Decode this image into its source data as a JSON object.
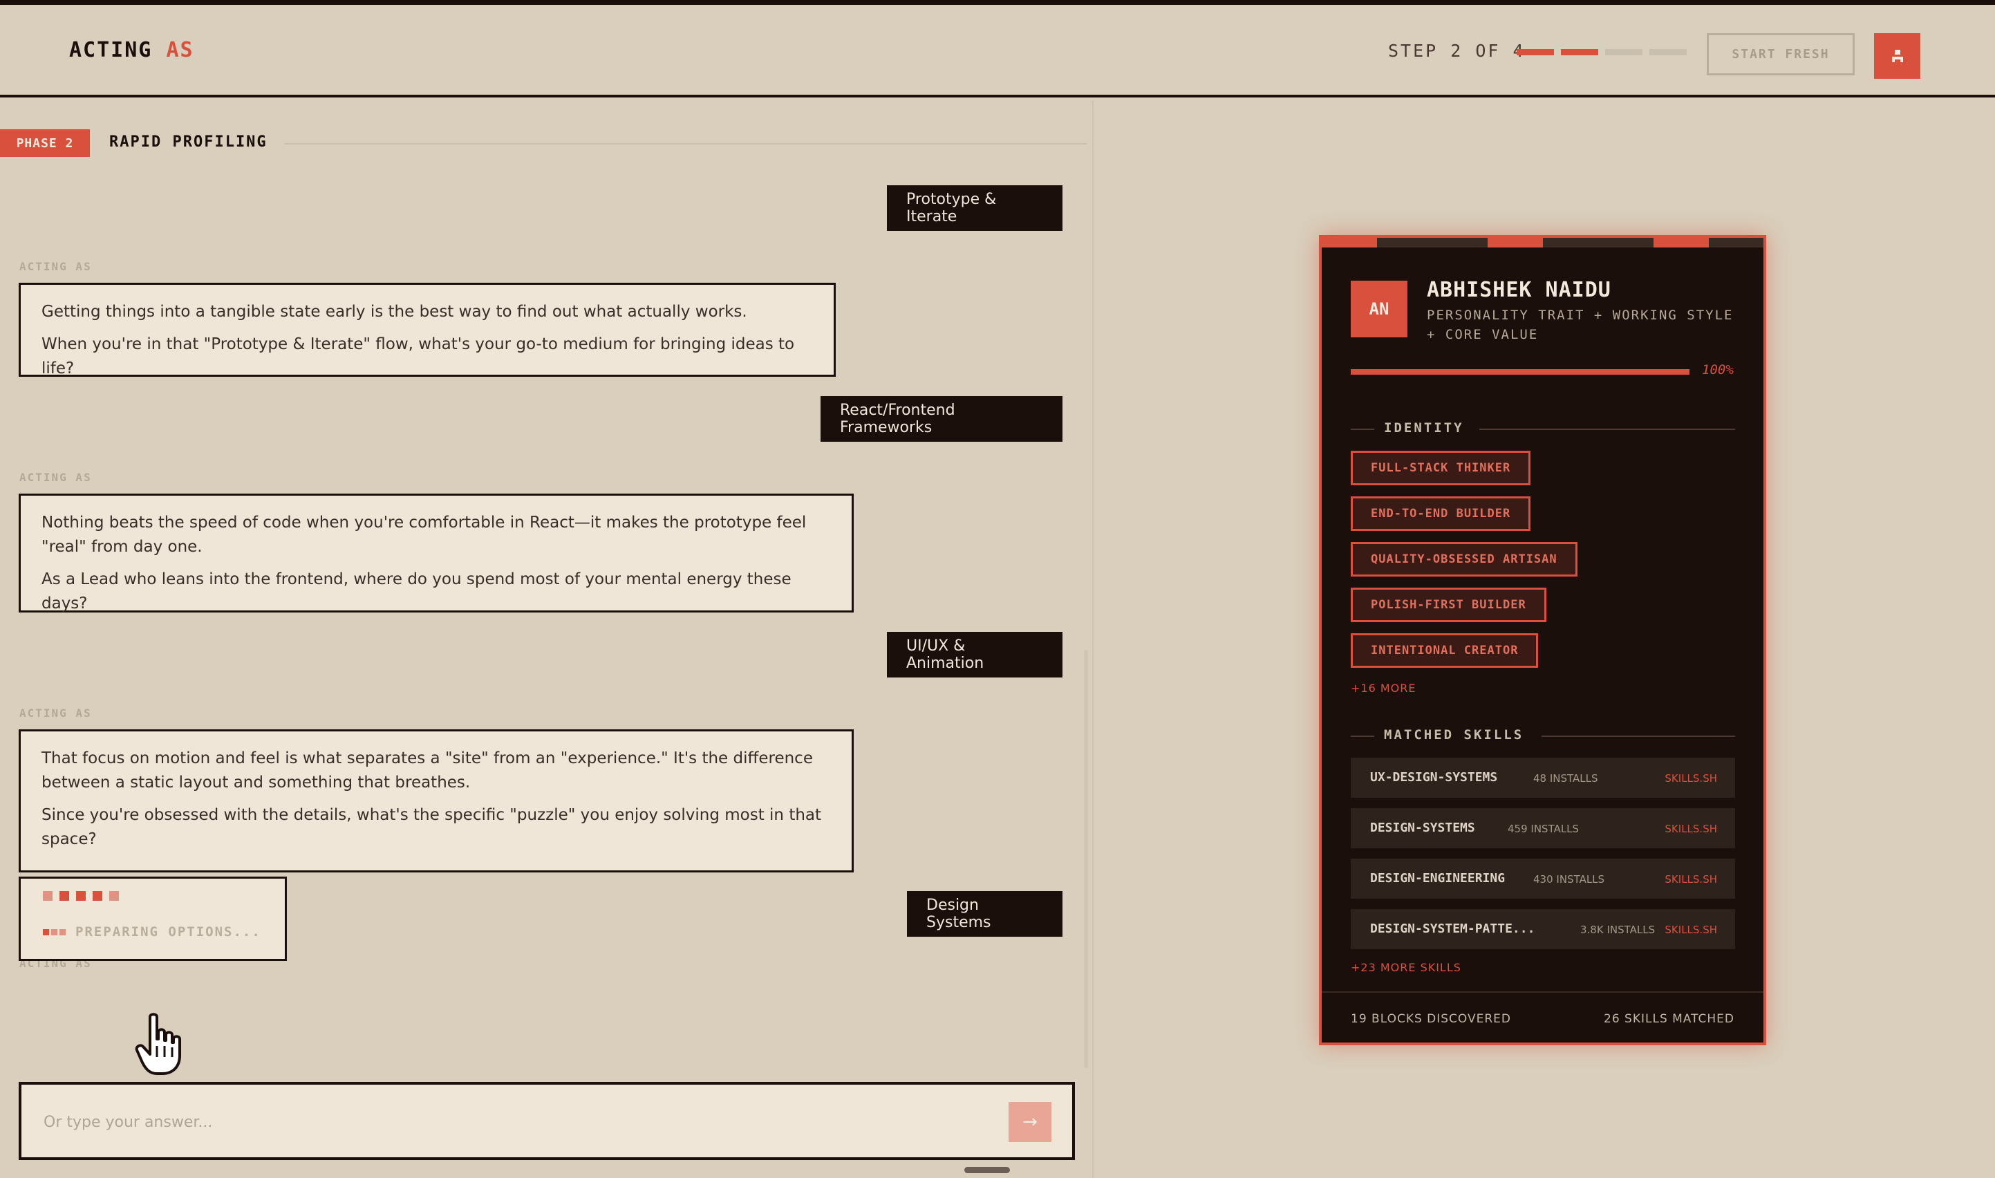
{
  "app": {
    "brand_main": "Acting",
    "brand_accent": "AS"
  },
  "header": {
    "step_text": "STEP 2 OF 4",
    "steps_total": 4,
    "steps_done": 2,
    "start_fresh_label": "START FRESH",
    "user_icon": "user-icon"
  },
  "phase": {
    "badge": "PHASE 2",
    "title": "RAPID PROFILING"
  },
  "conversation": {
    "user_messages": [
      "Prototype & Iterate",
      "React/Frontend Frameworks",
      "UI/UX & Animation",
      "Design Systems"
    ],
    "ai_label": "ACTING AS",
    "ai_messages": [
      {
        "lines": [
          "Getting things into a tangible state early is the best way to find out what actually works.",
          "When you're in that \"Prototype & Iterate\" flow, what's your go-to medium for bringing ideas to life?"
        ]
      },
      {
        "lines": [
          "Nothing beats the speed of code when you're comfortable in React—it makes the prototype feel \"real\" from day one.",
          "As a Lead who leans into the frontend, where do you spend most of your mental energy these days?"
        ]
      },
      {
        "lines": [
          "That focus on motion and feel is what separates a \"site\" from an \"experience.\" It's the difference between a static layout and something that breathes.",
          "Since you're obsessed with the details, what's the specific \"puzzle\" you enjoy solving most in that space?"
        ]
      }
    ],
    "loading_text": "PREPARING OPTIONS..."
  },
  "input": {
    "placeholder": "Or type your answer...",
    "send_icon": "arrow-right-icon"
  },
  "profile_card": {
    "initials": "AN",
    "name": "ABHISHEK NAIDU",
    "subtitle": "PERSONALITY TRAIT + WORKING STYLE + CORE VALUE",
    "progress_percent": 100,
    "progress_label": "100%",
    "identity_heading": "IDENTITY",
    "identity_tags": [
      "FULL-STACK THINKER",
      "END-TO-END BUILDER",
      "QUALITY-OBSESSED ARTISAN",
      "POLISH-FIRST BUILDER",
      "INTENTIONAL CREATOR"
    ],
    "identity_more": "+16 MORE",
    "skills_heading": "MATCHED SKILLS",
    "skills": [
      {
        "name": "UX-DESIGN-SYSTEMS",
        "installs": "48 INSTALLS",
        "source": "SKILLS.SH"
      },
      {
        "name": "DESIGN-SYSTEMS",
        "installs": "459 INSTALLS",
        "source": "SKILLS.SH"
      },
      {
        "name": "DESIGN-ENGINEERING",
        "installs": "430 INSTALLS",
        "source": "SKILLS.SH"
      },
      {
        "name": "DESIGN-SYSTEM-PATTE...",
        "installs": "3.8K INSTALLS",
        "source": "SKILLS.SH"
      }
    ],
    "skills_more": "+23 MORE SKILLS",
    "footer_left": "19 BLOCKS DISCOVERED",
    "footer_right": "26 SKILLS MATCHED"
  },
  "colors": {
    "background": "#d9cfbc",
    "ink": "#1a0f0b",
    "accent": "#d9503c",
    "bubble": "#efe6d8"
  }
}
